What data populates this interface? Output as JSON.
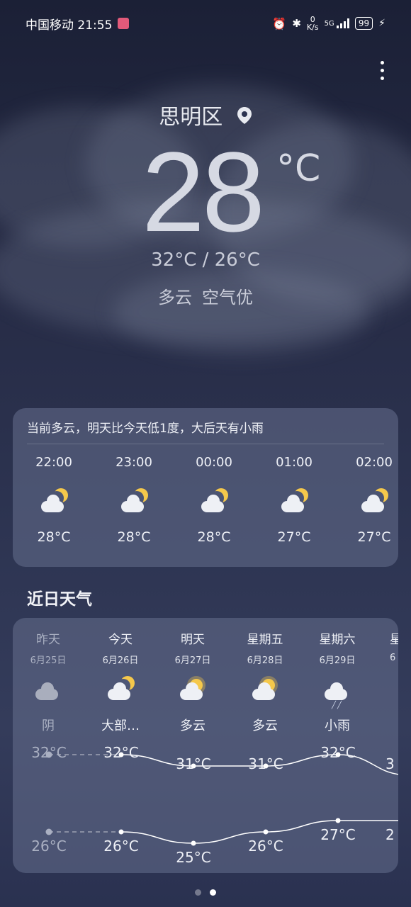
{
  "status": {
    "carrier_time": "中国移动 21:55",
    "net_speed_value": "0",
    "net_speed_unit": "K/s",
    "signal_label": "5G",
    "battery": "99"
  },
  "location": {
    "name": "思明区",
    "icon": "location-pin-icon"
  },
  "current": {
    "temp": "28",
    "unit": "°C",
    "range": "32°C / 26°C",
    "condition": "多云",
    "air": "空气优"
  },
  "hourly": {
    "summary": "当前多云，明天比今天低1度，大后天有小雨",
    "items": [
      {
        "time": "22:00",
        "icon": "moon-cloud-icon",
        "temp": "28°C"
      },
      {
        "time": "23:00",
        "icon": "moon-cloud-icon",
        "temp": "28°C"
      },
      {
        "time": "00:00",
        "icon": "moon-cloud-icon",
        "temp": "28°C"
      },
      {
        "time": "01:00",
        "icon": "moon-cloud-icon",
        "temp": "27°C"
      },
      {
        "time": "02:00",
        "icon": "moon-cloud-icon",
        "temp": "27°C"
      }
    ]
  },
  "daily": {
    "title": "近日天气",
    "items": [
      {
        "name": "昨天",
        "date": "6月25日",
        "icon": "overcast-icon",
        "desc": "阴",
        "high": "32°C",
        "low": "26°C",
        "high_value": 32,
        "low_value": 26
      },
      {
        "name": "今天",
        "date": "6月26日",
        "icon": "moon-cloud-icon",
        "desc": "大部…",
        "high": "32°C",
        "low": "26°C",
        "high_value": 32,
        "low_value": 26
      },
      {
        "name": "明天",
        "date": "6月27日",
        "icon": "sun-cloud-icon",
        "desc": "多云",
        "high": "31°C",
        "low": "25°C",
        "high_value": 31,
        "low_value": 25
      },
      {
        "name": "星期五",
        "date": "6月28日",
        "icon": "sun-cloud-icon",
        "desc": "多云",
        "high": "31°C",
        "low": "26°C",
        "high_value": 31,
        "low_value": 26
      },
      {
        "name": "星期六",
        "date": "6月29日",
        "icon": "light-rain-icon",
        "desc": "小雨",
        "high": "32°C",
        "low": "27°C",
        "high_value": 32,
        "low_value": 27
      }
    ],
    "partial_next_name": "星",
    "partial_next_date": "6",
    "partial_next_high": "3",
    "partial_next_low": "2"
  },
  "pager": {
    "total_pages": 2,
    "active_page": 2
  },
  "colors": {
    "moon": "#f5c84b",
    "cloud": "#eef0f5",
    "card": "#5f6887"
  }
}
